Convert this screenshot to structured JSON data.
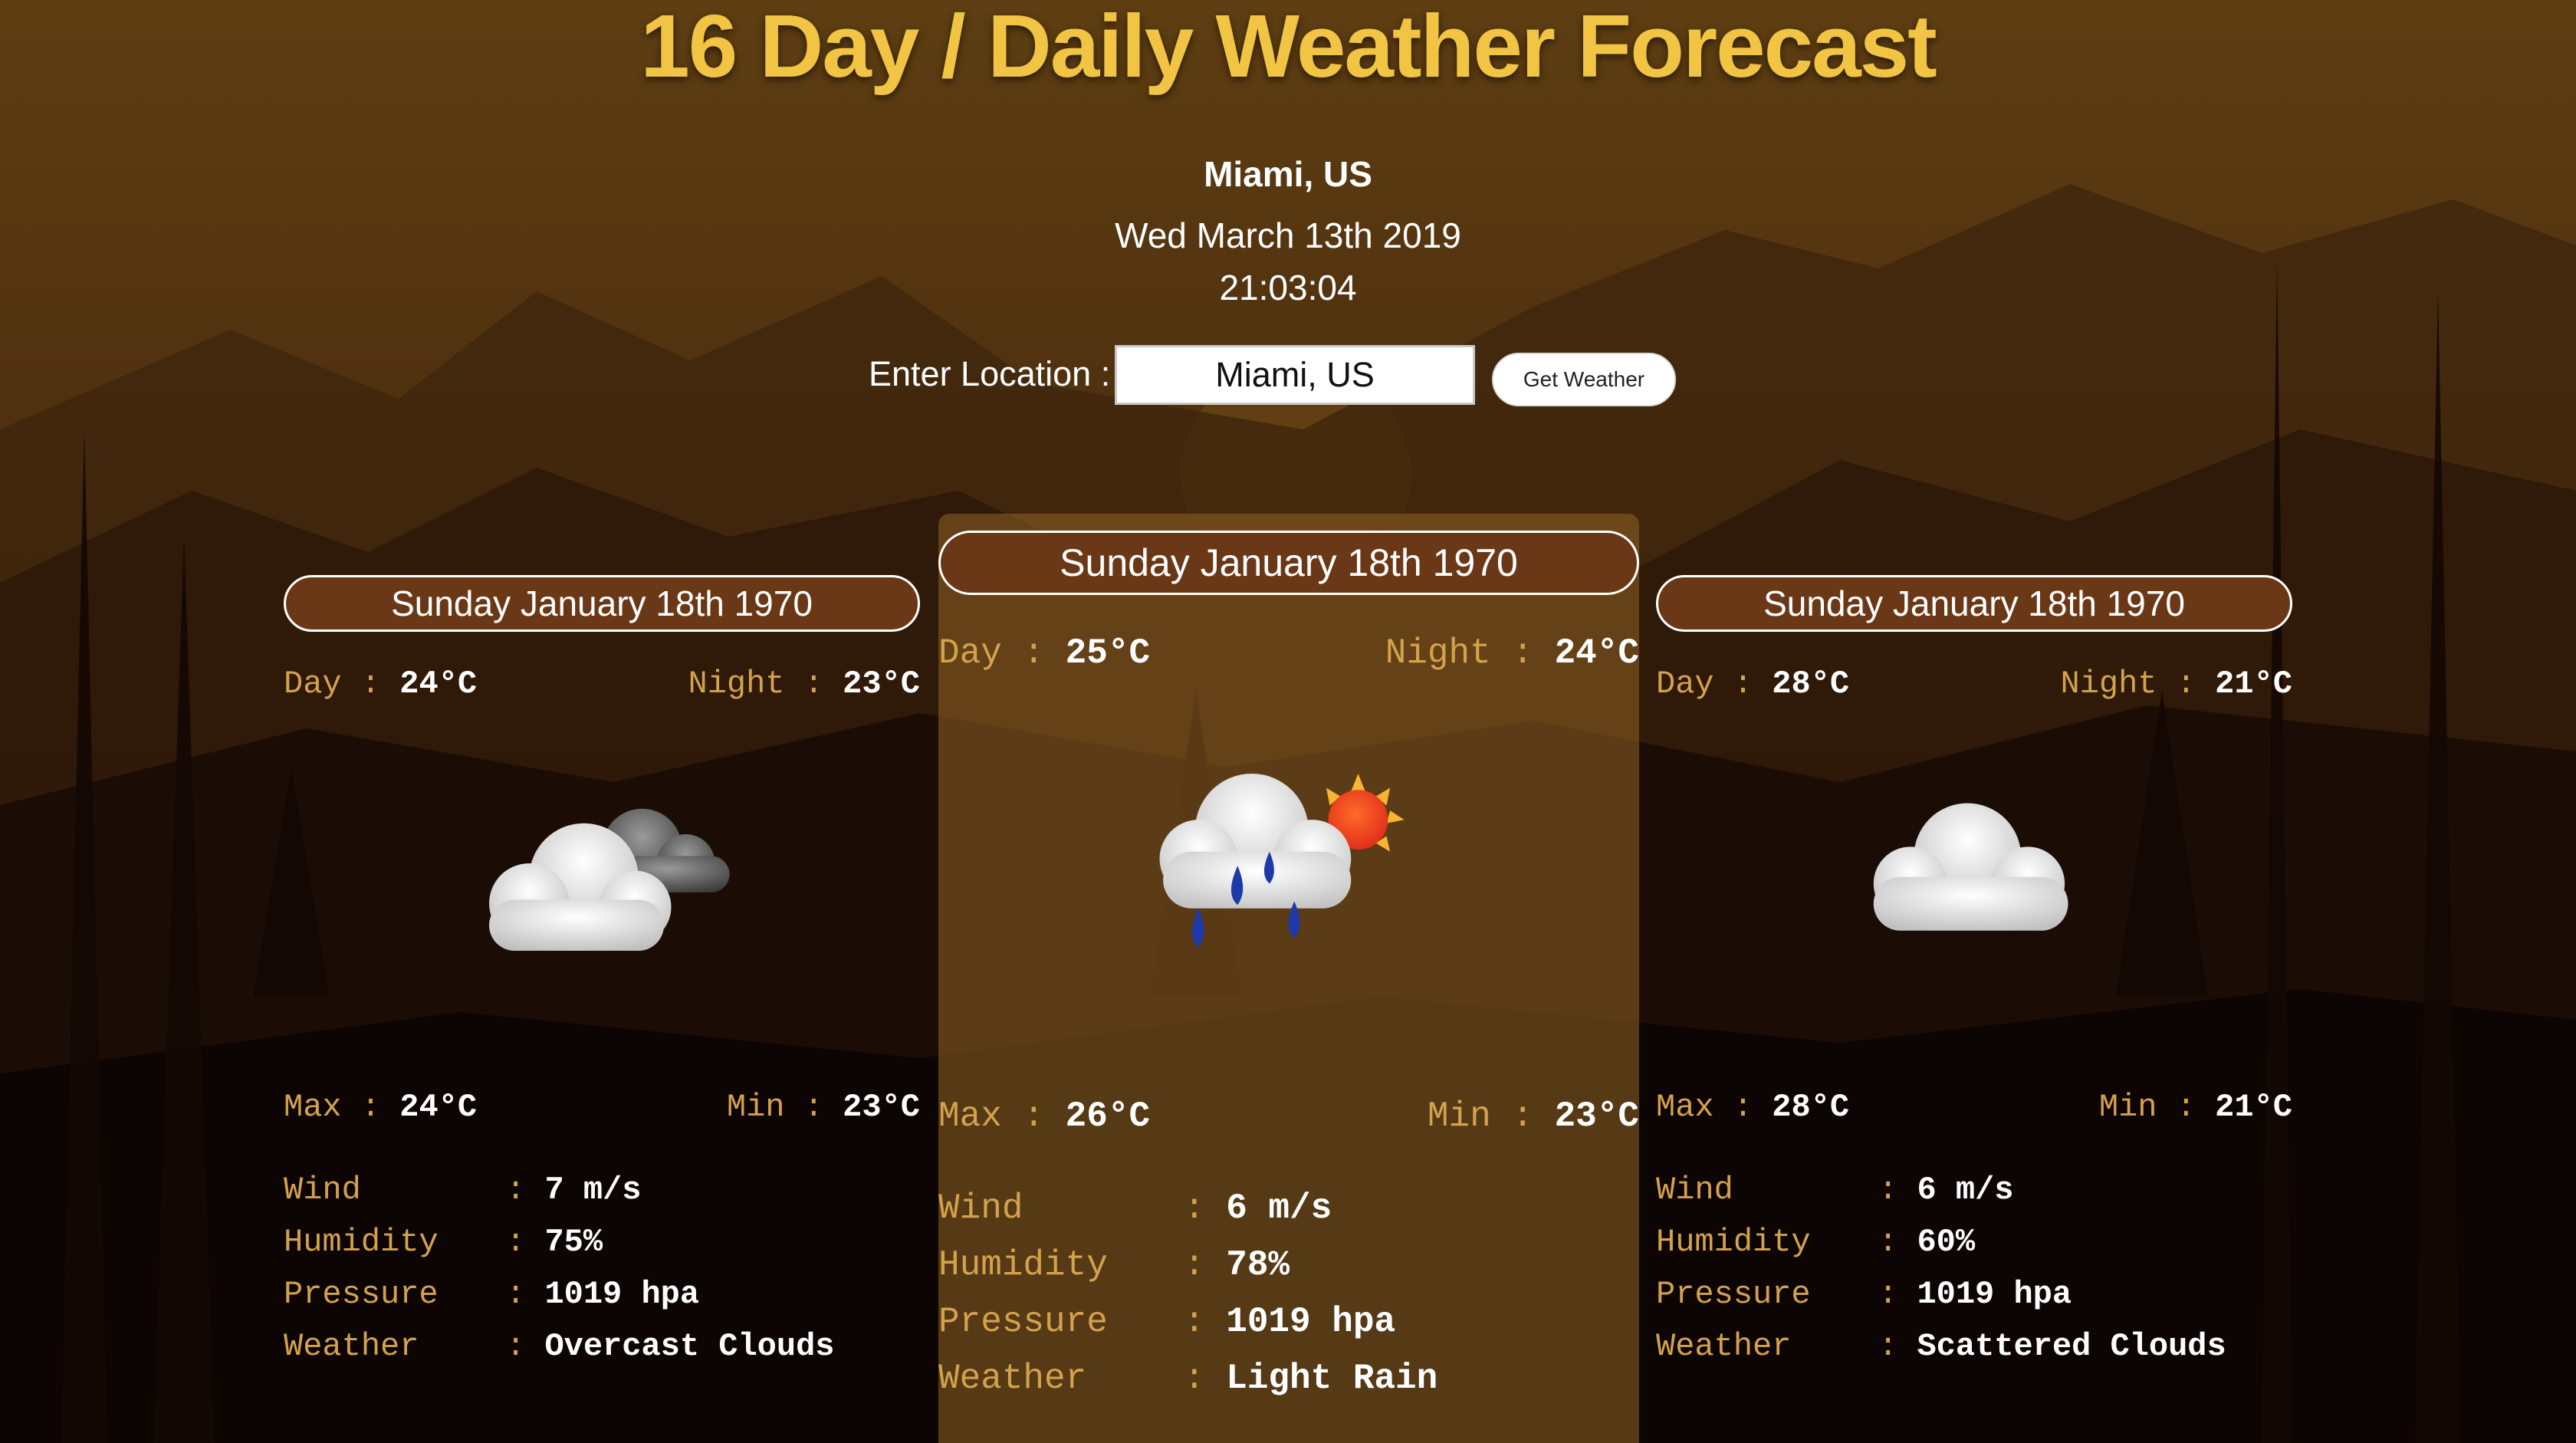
{
  "header": {
    "title": "16 Day / Daily Weather Forecast",
    "city": "Miami, US",
    "date": "Wed March 13th 2019",
    "time": "21:03:04"
  },
  "search": {
    "label": "Enter Location :",
    "value": "Miami, US",
    "button_label": "Get Weather"
  },
  "colors": {
    "title": "#f2c443",
    "label": "#d4a24d",
    "pill": "#6b3817",
    "highlight_card": "#8c5f23"
  },
  "cards": [
    {
      "date": "Sunday January 18th 1970",
      "day_label": "Day",
      "day": "24°C",
      "night_label": "Night",
      "night": "23°C",
      "max_label": "Max",
      "max": "24°C",
      "min_label": "Min",
      "min": "23°C",
      "wind_label": "Wind",
      "wind": "7 m/s",
      "humidity_label": "Humidity",
      "humidity": "75%",
      "pressure_label": "Pressure",
      "pressure": "1019 hpa",
      "weather_label": "Weather",
      "weather": "Overcast Clouds",
      "icon": "overcast-clouds-icon",
      "sep": ":"
    },
    {
      "date": "Sunday January 18th 1970",
      "day_label": "Day",
      "day": "25°C",
      "night_label": "Night",
      "night": "24°C",
      "max_label": "Max",
      "max": "26°C",
      "min_label": "Min",
      "min": "23°C",
      "wind_label": "Wind",
      "wind": "6 m/s",
      "humidity_label": "Humidity",
      "humidity": "78%",
      "pressure_label": "Pressure",
      "pressure": "1019 hpa",
      "weather_label": "Weather",
      "weather": "Light Rain",
      "icon": "light-rain-icon",
      "sep": ":"
    },
    {
      "date": "Sunday January 18th 1970",
      "day_label": "Day",
      "day": "28°C",
      "night_label": "Night",
      "night": "21°C",
      "max_label": "Max",
      "max": "28°C",
      "min_label": "Min",
      "min": "21°C",
      "wind_label": "Wind",
      "wind": "6 m/s",
      "humidity_label": "Humidity",
      "humidity": "60%",
      "pressure_label": "Pressure",
      "pressure": "1019 hpa",
      "weather_label": "Weather",
      "weather": "Scattered Clouds",
      "icon": "scattered-clouds-icon",
      "sep": ":"
    }
  ]
}
